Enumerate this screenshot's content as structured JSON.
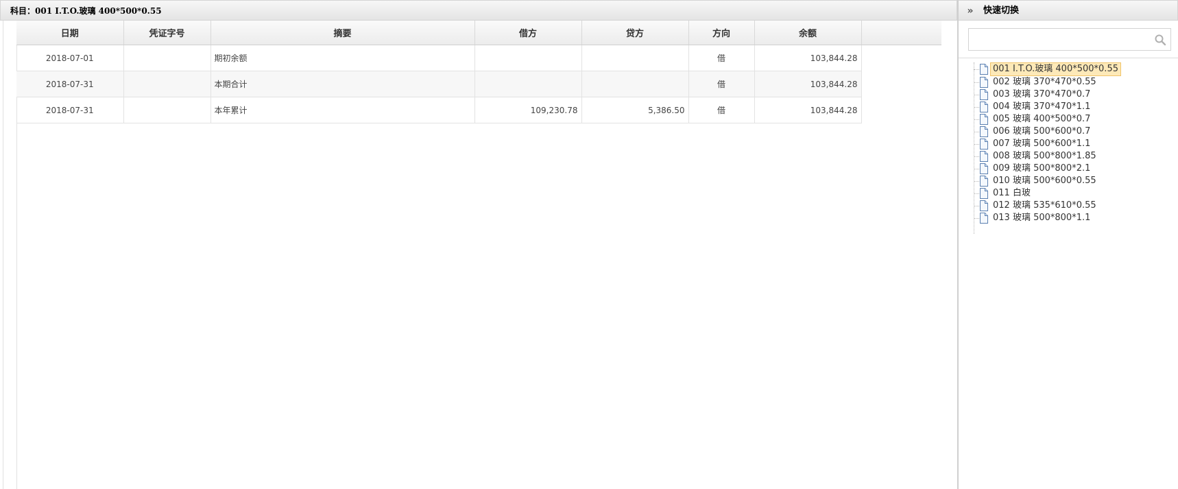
{
  "left_header": {
    "title": "科目：001 I.T.O.玻璃 400*500*0.55"
  },
  "grid": {
    "columns": [
      "日期",
      "凭证字号",
      "摘要",
      "借方",
      "贷方",
      "方向",
      "余额"
    ],
    "rows": [
      {
        "date": "2018-07-01",
        "voucher": "",
        "summary": "期初余额",
        "debit": "",
        "credit": "",
        "direction": "借",
        "balance": "103,844.28"
      },
      {
        "date": "2018-07-31",
        "voucher": "",
        "summary": "本期合计",
        "debit": "",
        "credit": "",
        "direction": "借",
        "balance": "103,844.28"
      },
      {
        "date": "2018-07-31",
        "voucher": "",
        "summary": "本年累计",
        "debit": "109,230.78",
        "credit": "5,386.50",
        "direction": "借",
        "balance": "103,844.28"
      }
    ]
  },
  "right_panel": {
    "title": "快速切换",
    "collapse_glyph": "»",
    "search": {
      "value": "",
      "placeholder": ""
    },
    "items": [
      {
        "label": "001 I.T.O.玻璃 400*500*0.55",
        "selected": true
      },
      {
        "label": "002 玻璃 370*470*0.55"
      },
      {
        "label": "003 玻璃 370*470*0.7"
      },
      {
        "label": "004 玻璃 370*470*1.1"
      },
      {
        "label": "005 玻璃 400*500*0.7"
      },
      {
        "label": "006 玻璃 500*600*0.7"
      },
      {
        "label": "007 玻璃 500*600*1.1"
      },
      {
        "label": "008 玻璃 500*800*1.85"
      },
      {
        "label": "009 玻璃 500*800*2.1"
      },
      {
        "label": "010 玻璃 500*600*0.55"
      },
      {
        "label": "011 白玻"
      },
      {
        "label": "012 玻璃 535*610*0.55"
      },
      {
        "label": "013 玻璃 500*800*1.1"
      }
    ]
  }
}
